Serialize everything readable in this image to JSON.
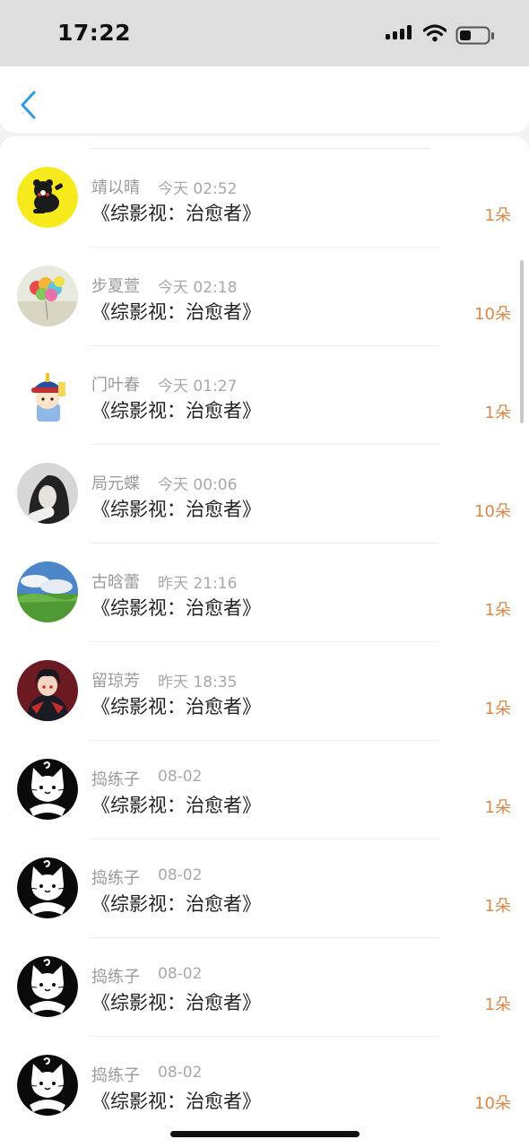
{
  "status_bar": {
    "time": "17:22",
    "icons": [
      "signal-icon",
      "wifi-icon",
      "battery-icon"
    ]
  },
  "nav": {
    "back_icon": "chevron-left-icon",
    "accent_color": "#2f9be0"
  },
  "list": {
    "amount_color": "#d9874a",
    "items": [
      {
        "avatar": "yellow-bear-avatar",
        "name": "靖以晴",
        "time": "今天 02:52",
        "book": "《综影视：治愈者》",
        "amount": "1朵"
      },
      {
        "avatar": "balloons-avatar",
        "name": "步夏萱",
        "time": "今天 02:18",
        "book": "《综影视：治愈者》",
        "amount": "10朵"
      },
      {
        "avatar": "cartoon-boy-avatar",
        "name": "门叶春",
        "time": "今天 01:27",
        "book": "《综影视：治愈者》",
        "amount": "1朵"
      },
      {
        "avatar": "woman-portrait-avatar",
        "name": "局元蝶",
        "time": "今天 00:06",
        "book": "《综影视：治愈者》",
        "amount": "10朵"
      },
      {
        "avatar": "landscape-avatar",
        "name": "古晗蕾",
        "time": "昨天 21:16",
        "book": "《综影视：治愈者》",
        "amount": "1朵"
      },
      {
        "avatar": "anime-avatar",
        "name": "留琼芳",
        "time": "昨天 18:35",
        "book": "《综影视：治愈者》",
        "amount": "1朵"
      },
      {
        "avatar": "cat-avatar",
        "name": "捣练子",
        "time": "08-02",
        "book": "《综影视：治愈者》",
        "amount": "1朵"
      },
      {
        "avatar": "cat-avatar",
        "name": "捣练子",
        "time": "08-02",
        "book": "《综影视：治愈者》",
        "amount": "1朵"
      },
      {
        "avatar": "cat-avatar",
        "name": "捣练子",
        "time": "08-02",
        "book": "《综影视：治愈者》",
        "amount": "1朵"
      },
      {
        "avatar": "cat-avatar",
        "name": "捣练子",
        "time": "08-02",
        "book": "《综影视：治愈者》",
        "amount": "10朵"
      }
    ]
  }
}
